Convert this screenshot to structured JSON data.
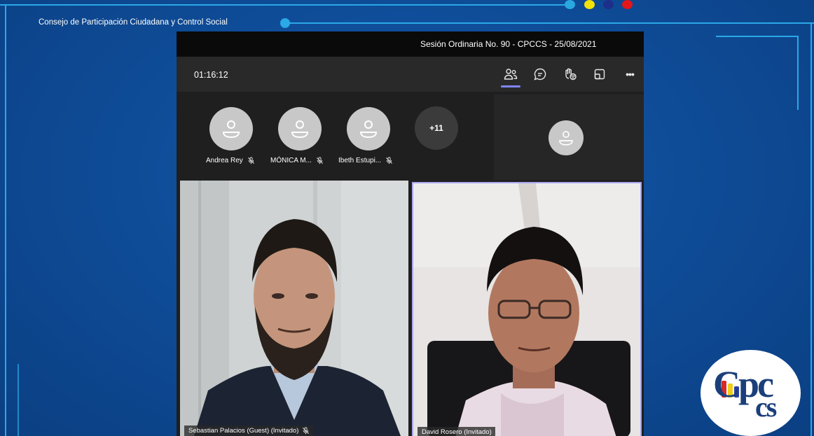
{
  "branding": {
    "org_name": "Consejo de Participación Ciudadana y Control Social",
    "logo_text_main": "Cpc",
    "logo_text_sub": "cs",
    "logo_text_i": "i",
    "dot_colors": [
      "#29a8e0",
      "#f2e207",
      "#1d2f8a",
      "#e3161a"
    ]
  },
  "meeting": {
    "title": "Sesión Ordinaria No. 90 - CPCCS - 25/08/2021",
    "timer": "01:16:12",
    "toolbar": {
      "participants_icon": "people-icon",
      "chat_icon": "chat-icon",
      "reactions_icon": "raise-hand-icon",
      "share_icon": "share-tray-icon",
      "more_label": "•••"
    },
    "participants": [
      {
        "name": "Andrea Rey",
        "muted": true
      },
      {
        "name": "MÓNICA M...",
        "muted": true
      },
      {
        "name": "Ibeth Estupi...",
        "muted": true
      }
    ],
    "overflow_label": "+11",
    "videos": [
      {
        "name": "Sebastian Palacios (Guest) (Invitado)",
        "muted": true
      },
      {
        "name": "David Rosero (Invitado)",
        "muted": false
      }
    ]
  },
  "colors": {
    "accent": "#7f85f5",
    "frame_line": "#2aa8e8",
    "background": "#0f4d99"
  }
}
